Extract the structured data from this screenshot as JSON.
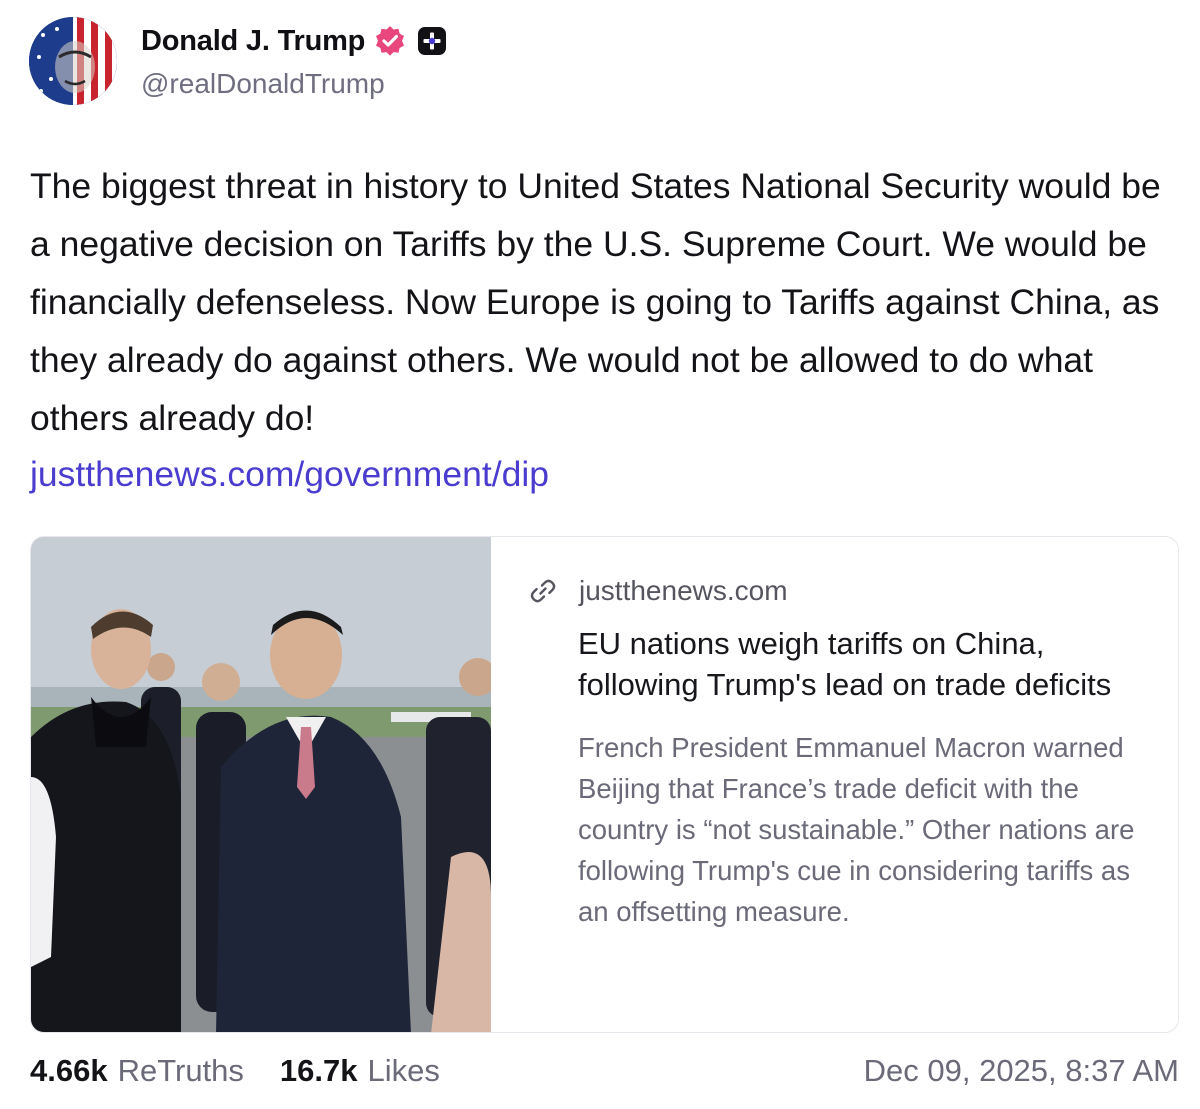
{
  "author": {
    "display_name": "Donald J. Trump",
    "handle": "@realDonaldTrump",
    "avatar_icon": "patriotic-portrait-avatar",
    "verified_icon": "verified-badge-icon",
    "verified_color": "#e8467c",
    "subscription_icon": "plus-badge-icon"
  },
  "post": {
    "text": "The biggest threat in history to United States National Security would be a negative decision on Tariffs by the U.S. Supreme Court. We would be financially defenseless. Now Europe is going to Tariffs against China, as they already do against others. We would not be allowed to do what others already do!",
    "link": "justthenews.com/government/dip",
    "link_color": "#4a3ccf"
  },
  "link_card": {
    "image_description_icon": "news-photo-thumbnail",
    "domain_icon": "link-icon",
    "domain": "justthenews.com",
    "title": "EU nations weigh tariffs on China, following Trump's lead on trade deficits",
    "description": "French President Emmanuel Macron warned Beijing that France’s trade deficit with the country is “not sustainable.” Other nations are following Trump's cue in considering tariffs as an offsetting measure."
  },
  "footer": {
    "retruths_count": "4.66k",
    "retruths_label": "ReTruths",
    "likes_count": "16.7k",
    "likes_label": "Likes",
    "timestamp": "Dec 09, 2025, 8:37 AM"
  }
}
